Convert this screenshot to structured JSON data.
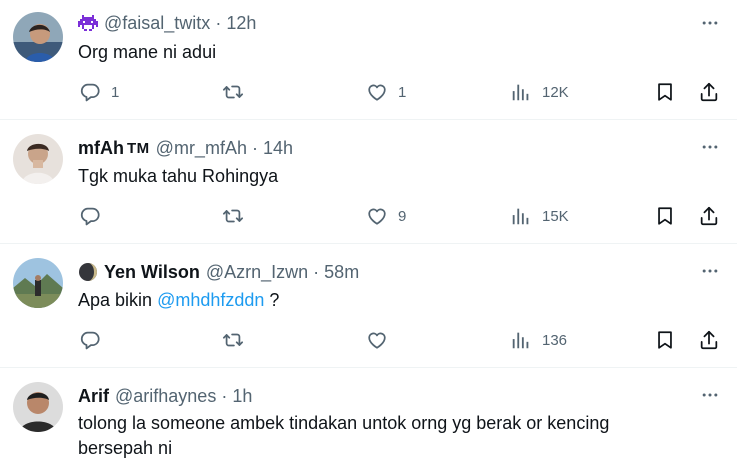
{
  "tweets": [
    {
      "name": "",
      "handle": "@faisal_twitx",
      "dot": "·",
      "time": "12h",
      "text": "Org mane ni adui",
      "mention": "",
      "text_suffix": "",
      "stats": {
        "replies": "1",
        "reposts": "",
        "likes": "1",
        "views": "12K"
      }
    },
    {
      "name": "mfAh",
      "name_suffix": "TM",
      "handle": "@mr_mfAh",
      "dot": "·",
      "time": "14h",
      "text": "Tgk muka tahu Rohingya",
      "stats": {
        "replies": "",
        "reposts": "",
        "likes": "9",
        "views": "15K"
      }
    },
    {
      "name": "Yen Wilson",
      "handle": "@Azrn_Izwn",
      "dot": "·",
      "time": "58m",
      "text": "Apa bikin ",
      "mention": "@mhdhfzddn",
      "text_suffix": " ?",
      "stats": {
        "replies": "",
        "reposts": "",
        "likes": "",
        "views": "136"
      }
    },
    {
      "name": "Arif",
      "handle": "@arifhaynes",
      "dot": "·",
      "time": "1h",
      "text_line1": "tolong la someone ambek tindakan untok orng yg berak or kencing",
      "text_line2": "bersepah ni"
    }
  ],
  "icons": {
    "reply": "reply-icon",
    "repost": "repost-icon",
    "like": "heart-icon",
    "views": "views-icon",
    "bookmark": "bookmark-icon",
    "share": "share-icon",
    "more": "more-icon"
  },
  "colors": {
    "text": "#0f1419",
    "muted": "#536471",
    "link": "#1d9bf0",
    "divider": "#eff3f4",
    "badge_purple": "#7b2fd8"
  }
}
